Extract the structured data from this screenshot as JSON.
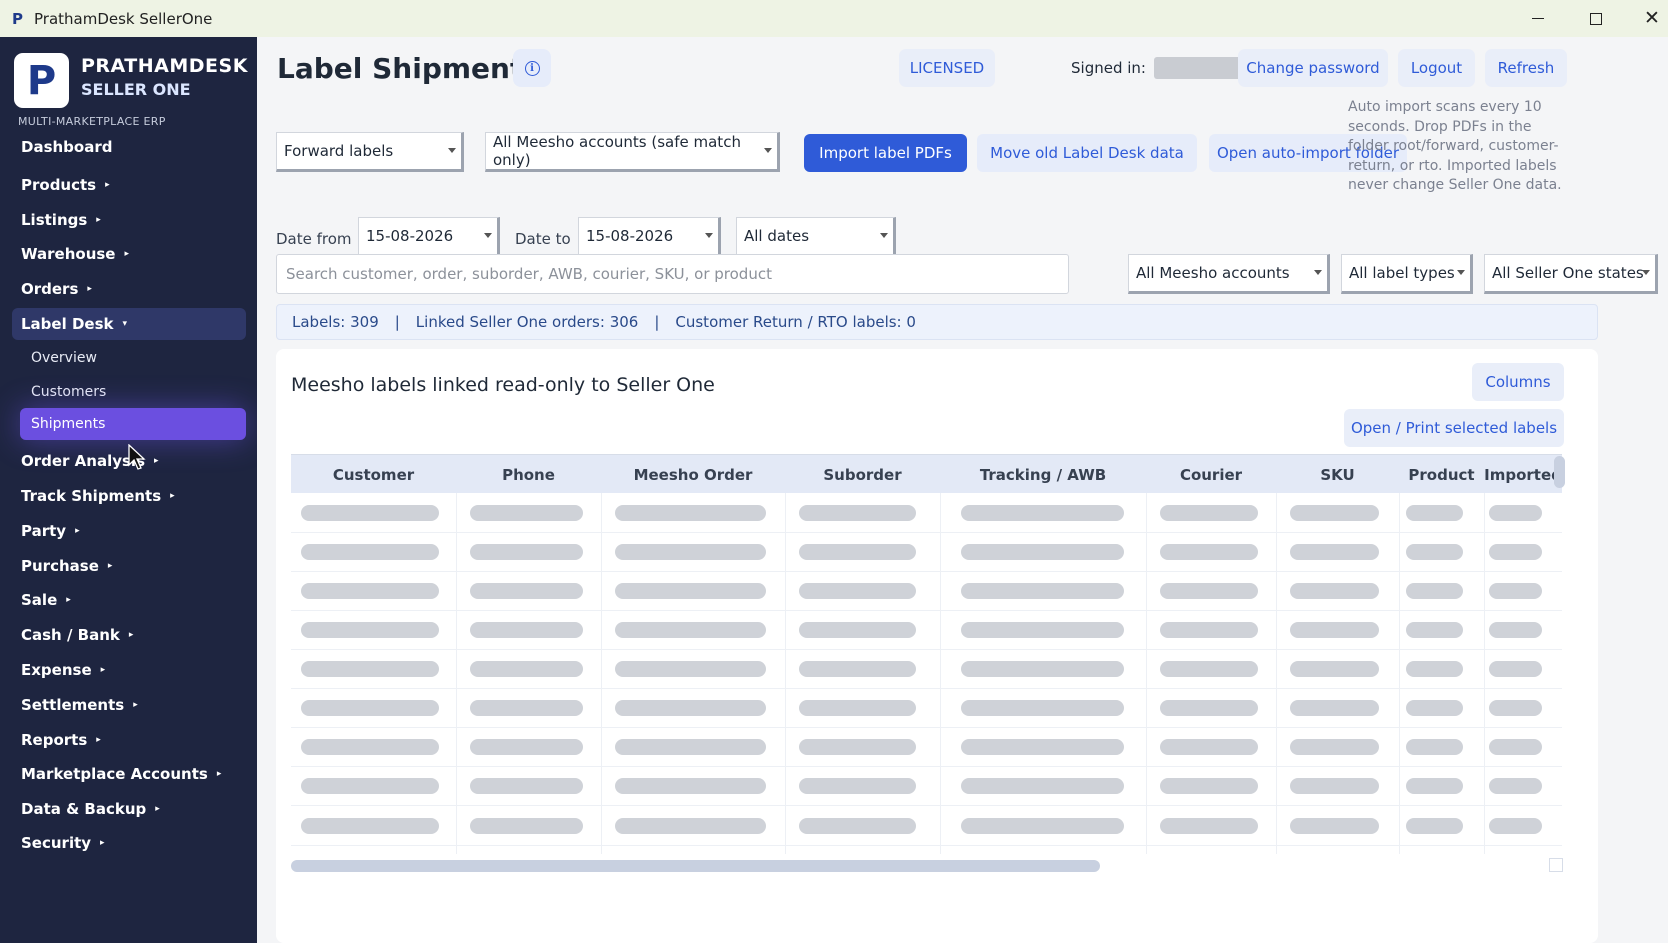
{
  "window": {
    "title": "PrathamDesk SellerOne",
    "app_icon": "P"
  },
  "brand": {
    "logo_letter": "P",
    "line1": "PRATHAMDESK",
    "line2": "SELLER ONE",
    "tagline": "MULTI-MARKETPLACE ERP"
  },
  "sidebar": {
    "items": [
      {
        "label": "Dashboard"
      },
      {
        "label": "Products"
      },
      {
        "label": "Listings"
      },
      {
        "label": "Warehouse"
      },
      {
        "label": "Orders"
      },
      {
        "label": "Label Desk"
      },
      {
        "label": "Order Analysis"
      },
      {
        "label": "Track Shipments"
      },
      {
        "label": "Party"
      },
      {
        "label": "Purchase"
      },
      {
        "label": "Sale"
      },
      {
        "label": "Cash / Bank"
      },
      {
        "label": "Expense"
      },
      {
        "label": "Settlements"
      },
      {
        "label": "Reports"
      },
      {
        "label": "Marketplace Accounts"
      },
      {
        "label": "Data & Backup"
      },
      {
        "label": "Security"
      }
    ],
    "sub_items": [
      {
        "label": "Overview"
      },
      {
        "label": "Customers"
      },
      {
        "label": "Shipments"
      }
    ],
    "caret_right": "▸",
    "caret_down": "▾"
  },
  "header": {
    "title": "Label Shipments",
    "license": "LICENSED",
    "signed_in_label": "Signed in:",
    "change_password": "Change password",
    "logout": "Logout",
    "refresh": "Refresh"
  },
  "toolbar": {
    "label_kind": "Forward labels",
    "account_scope": "All Meesho accounts (safe match only)",
    "import_btn": "Import label PDFs",
    "move_btn": "Move old Label Desk data",
    "open_folder_btn": "Open auto-import folder",
    "note": "Auto import scans every 10 seconds. Drop PDFs in the folder root/forward, customer-return, or rto. Imported labels never change Seller One data."
  },
  "filters": {
    "date_from_label": "Date from",
    "date_from": "15-08-2026",
    "date_to_label": "Date to",
    "date_to": "15-08-2026",
    "date_range": "All dates",
    "search_placeholder": "Search customer, order, suborder, AWB, courier, SKU, or product",
    "accounts": "All Meesho accounts",
    "label_types": "All label types",
    "states": "All Seller One states"
  },
  "stats": {
    "labels": "Labels: 309",
    "linked": "Linked Seller One orders: 306",
    "returns": "Customer Return / RTO labels: 0",
    "separator": "|"
  },
  "card": {
    "title": "Meesho labels linked read-only to Seller One",
    "columns_btn": "Columns",
    "print_btn": "Open / Print selected labels"
  },
  "table": {
    "columns": [
      "Customer",
      "Phone",
      "Meesho Order",
      "Suborder",
      "Tracking / AWB",
      "Courier",
      "SKU",
      "Product",
      "Imported"
    ],
    "loading_rows": 9
  },
  "colors": {
    "sidebar_bg": "#1e2540",
    "accent": "#2f5bd8",
    "active_sub": "#6b4fe0"
  }
}
